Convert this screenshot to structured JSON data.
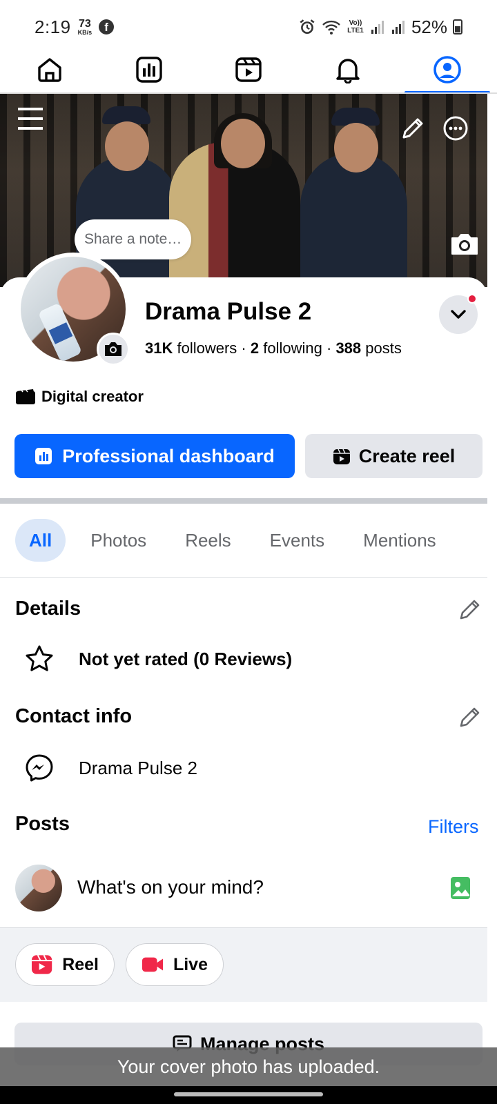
{
  "status_bar": {
    "time": "2:19",
    "speed_value": "73",
    "speed_unit": "KB/s",
    "network_label": "Vo)) LTE1",
    "battery": "52%"
  },
  "top_nav": {
    "tabs": [
      "home",
      "professional-dashboard",
      "video",
      "notifications",
      "profile"
    ],
    "active": "profile"
  },
  "cover": {
    "note_placeholder": "Share a note…"
  },
  "profile": {
    "name": "Drama Pulse 2",
    "followers_count": "31K",
    "followers_label": "followers",
    "following_count": "2",
    "following_label": "following",
    "posts_count": "388",
    "posts_label": "posts",
    "separator": "·",
    "category": "Digital creator"
  },
  "buttons": {
    "professional_dashboard": "Professional dashboard",
    "create_reel": "Create reel"
  },
  "tabs": [
    {
      "label": "All",
      "active": true
    },
    {
      "label": "Photos",
      "active": false
    },
    {
      "label": "Reels",
      "active": false
    },
    {
      "label": "Events",
      "active": false
    },
    {
      "label": "Mentions",
      "active": false
    }
  ],
  "details": {
    "title": "Details",
    "rating": "Not yet rated (0 Reviews)"
  },
  "contact": {
    "title": "Contact info",
    "messenger": "Drama Pulse 2"
  },
  "posts": {
    "title": "Posts",
    "filters": "Filters",
    "composer_prompt": "What's on your mind?",
    "reel_chip": "Reel",
    "live_chip": "Live",
    "manage": "Manage posts"
  },
  "toast": {
    "message": "Your cover photo has uploaded."
  },
  "colors": {
    "accent": "#0866ff",
    "chip_red": "#f02849",
    "photo_green": "#45bd62",
    "badge_red": "#e41e3f"
  }
}
